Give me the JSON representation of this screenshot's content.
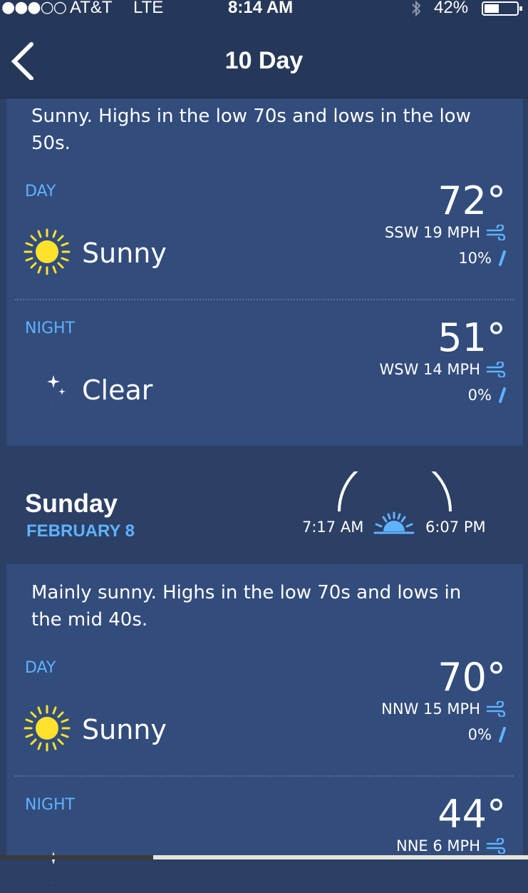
{
  "status_bar": {
    "signal": "●●●○○",
    "carrier": "AT&T",
    "network": "LTE",
    "time": "8:14 AM",
    "battery_pct": "42%"
  },
  "nav": {
    "title": "10 Day"
  },
  "saturday": {
    "summary": "Sunny. Highs in the low 70s and lows in the low 50s.",
    "day": {
      "label": "DAY",
      "temp": "72°",
      "wind": "SSW 19 MPH",
      "precip": "10%",
      "condition": "Sunny",
      "icon": "sun-icon"
    },
    "night": {
      "label": "NIGHT",
      "temp": "51°",
      "wind": "WSW 14 MPH",
      "precip": "0%",
      "condition": "Clear",
      "icon": "moon-stars-icon"
    }
  },
  "sunday_header": {
    "day_name": "Sunday",
    "date": "FEBRUARY 8",
    "sunrise": "7:17 AM",
    "sunset": "6:07 PM"
  },
  "sunday": {
    "summary": "Mainly sunny. Highs in the low 70s and lows in the mid 40s.",
    "day": {
      "label": "DAY",
      "temp": "70°",
      "wind": "NNW 15 MPH",
      "precip": "0%",
      "condition": "Sunny",
      "icon": "sun-icon"
    },
    "night": {
      "label": "NIGHT",
      "temp": "44°",
      "wind": "NNE 6 MPH",
      "icon": "moon-stars-icon"
    }
  },
  "colors": {
    "background": "#2c3f65",
    "card": "#324c7c",
    "accent_blue": "#5fb2ff",
    "sun_yellow": "#ffe22b"
  }
}
